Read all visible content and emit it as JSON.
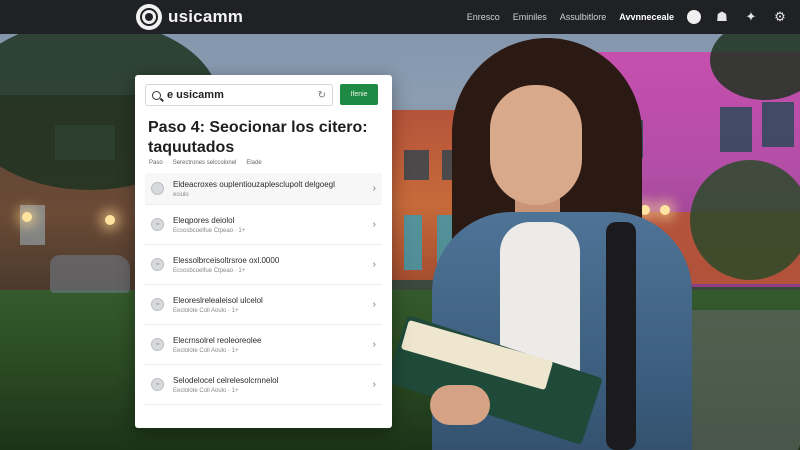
{
  "header": {
    "brand": "usicamm",
    "nav": [
      "Enresco",
      "Eminiles",
      "Assulbitlore",
      "Avvnneceale"
    ],
    "active_nav_index": 3,
    "icons": [
      "moon-icon",
      "user-icon",
      "sparkle-icon",
      "settings-icon"
    ]
  },
  "panel": {
    "search": {
      "value": "e usicamm"
    },
    "go_button": "Ifenie",
    "title": "Paso 4: Seocionar los citero: taquutados",
    "meta": [
      "Paso",
      "Serectrones selccolonel",
      "Elade"
    ],
    "items": [
      {
        "title": "Eldeacroxes ouplentiouzaplesclupolt delgoegl",
        "sub": "eciulo"
      },
      {
        "title": "Eleqpores deiolol",
        "sub": "Ecsosbcoelfue Ctpeao · 1+"
      },
      {
        "title": "Elessolbrceisoltrsroe oxl.0000",
        "sub": "Ecsosbcoelfue Ctpeao · 1+"
      },
      {
        "title": "Eleoreslrelealeisol ulcelol",
        "sub": "Eeclolote Coll Aoulo · 1+"
      },
      {
        "title": "Elecrnsolrel reoleoreolee",
        "sub": "Eeclolote Coll Aoulo · 1+"
      },
      {
        "title": "Selodelocel celrelesolcrnnelol",
        "sub": "Eeclolote Coll Aoulo · 1+"
      }
    ]
  },
  "colors": {
    "accent": "#1f8a43",
    "topbar": "#1f2124",
    "panel": "#ffffff"
  }
}
